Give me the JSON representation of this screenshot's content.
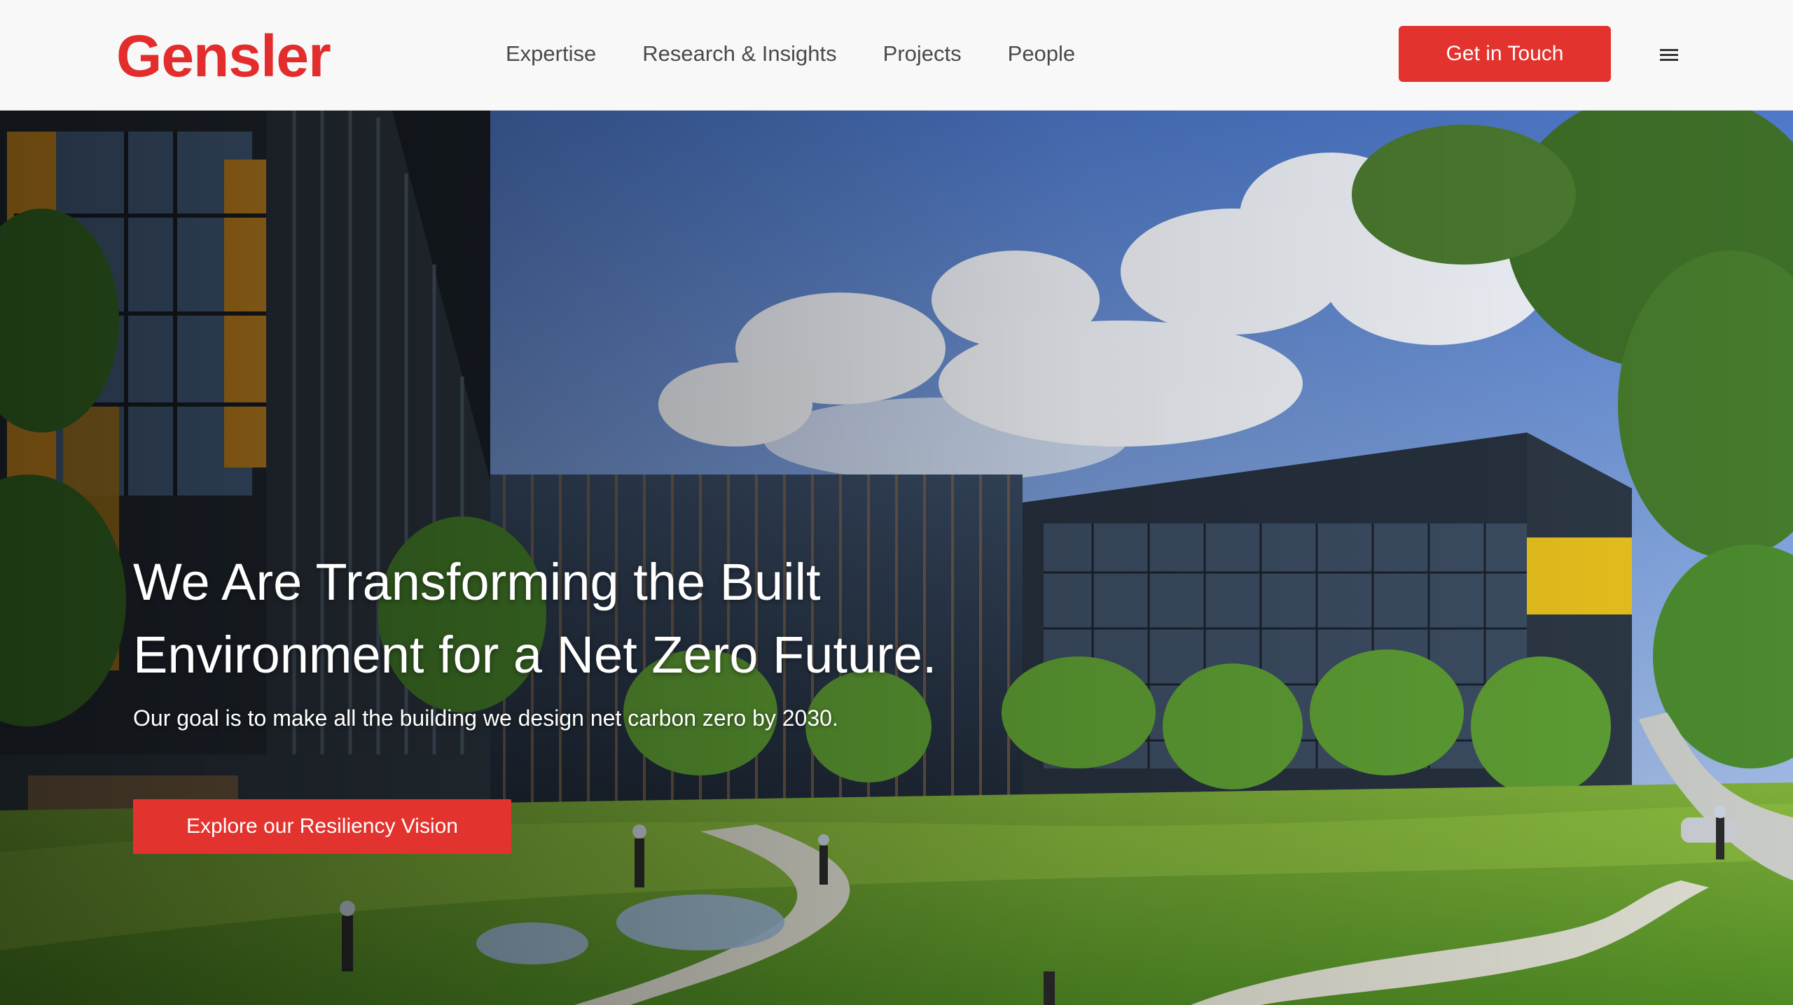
{
  "header": {
    "logo": "Gensler",
    "nav": [
      "Expertise",
      "Research & Insights",
      "Projects",
      "People"
    ],
    "cta": "Get in Touch",
    "menu_icon": "hamburger-menu-icon"
  },
  "hero": {
    "title_line1": "We Are Transforming the Built",
    "title_line2": "Environment for a Net Zero Future.",
    "subtitle": "Our goal is to make all the building we design net carbon zero by 2030.",
    "cta": "Explore our Resiliency Vision"
  },
  "colors": {
    "brand_red": "#e32c2c",
    "header_bg": "#f8f8f8",
    "nav_text": "#4a4a4a"
  }
}
